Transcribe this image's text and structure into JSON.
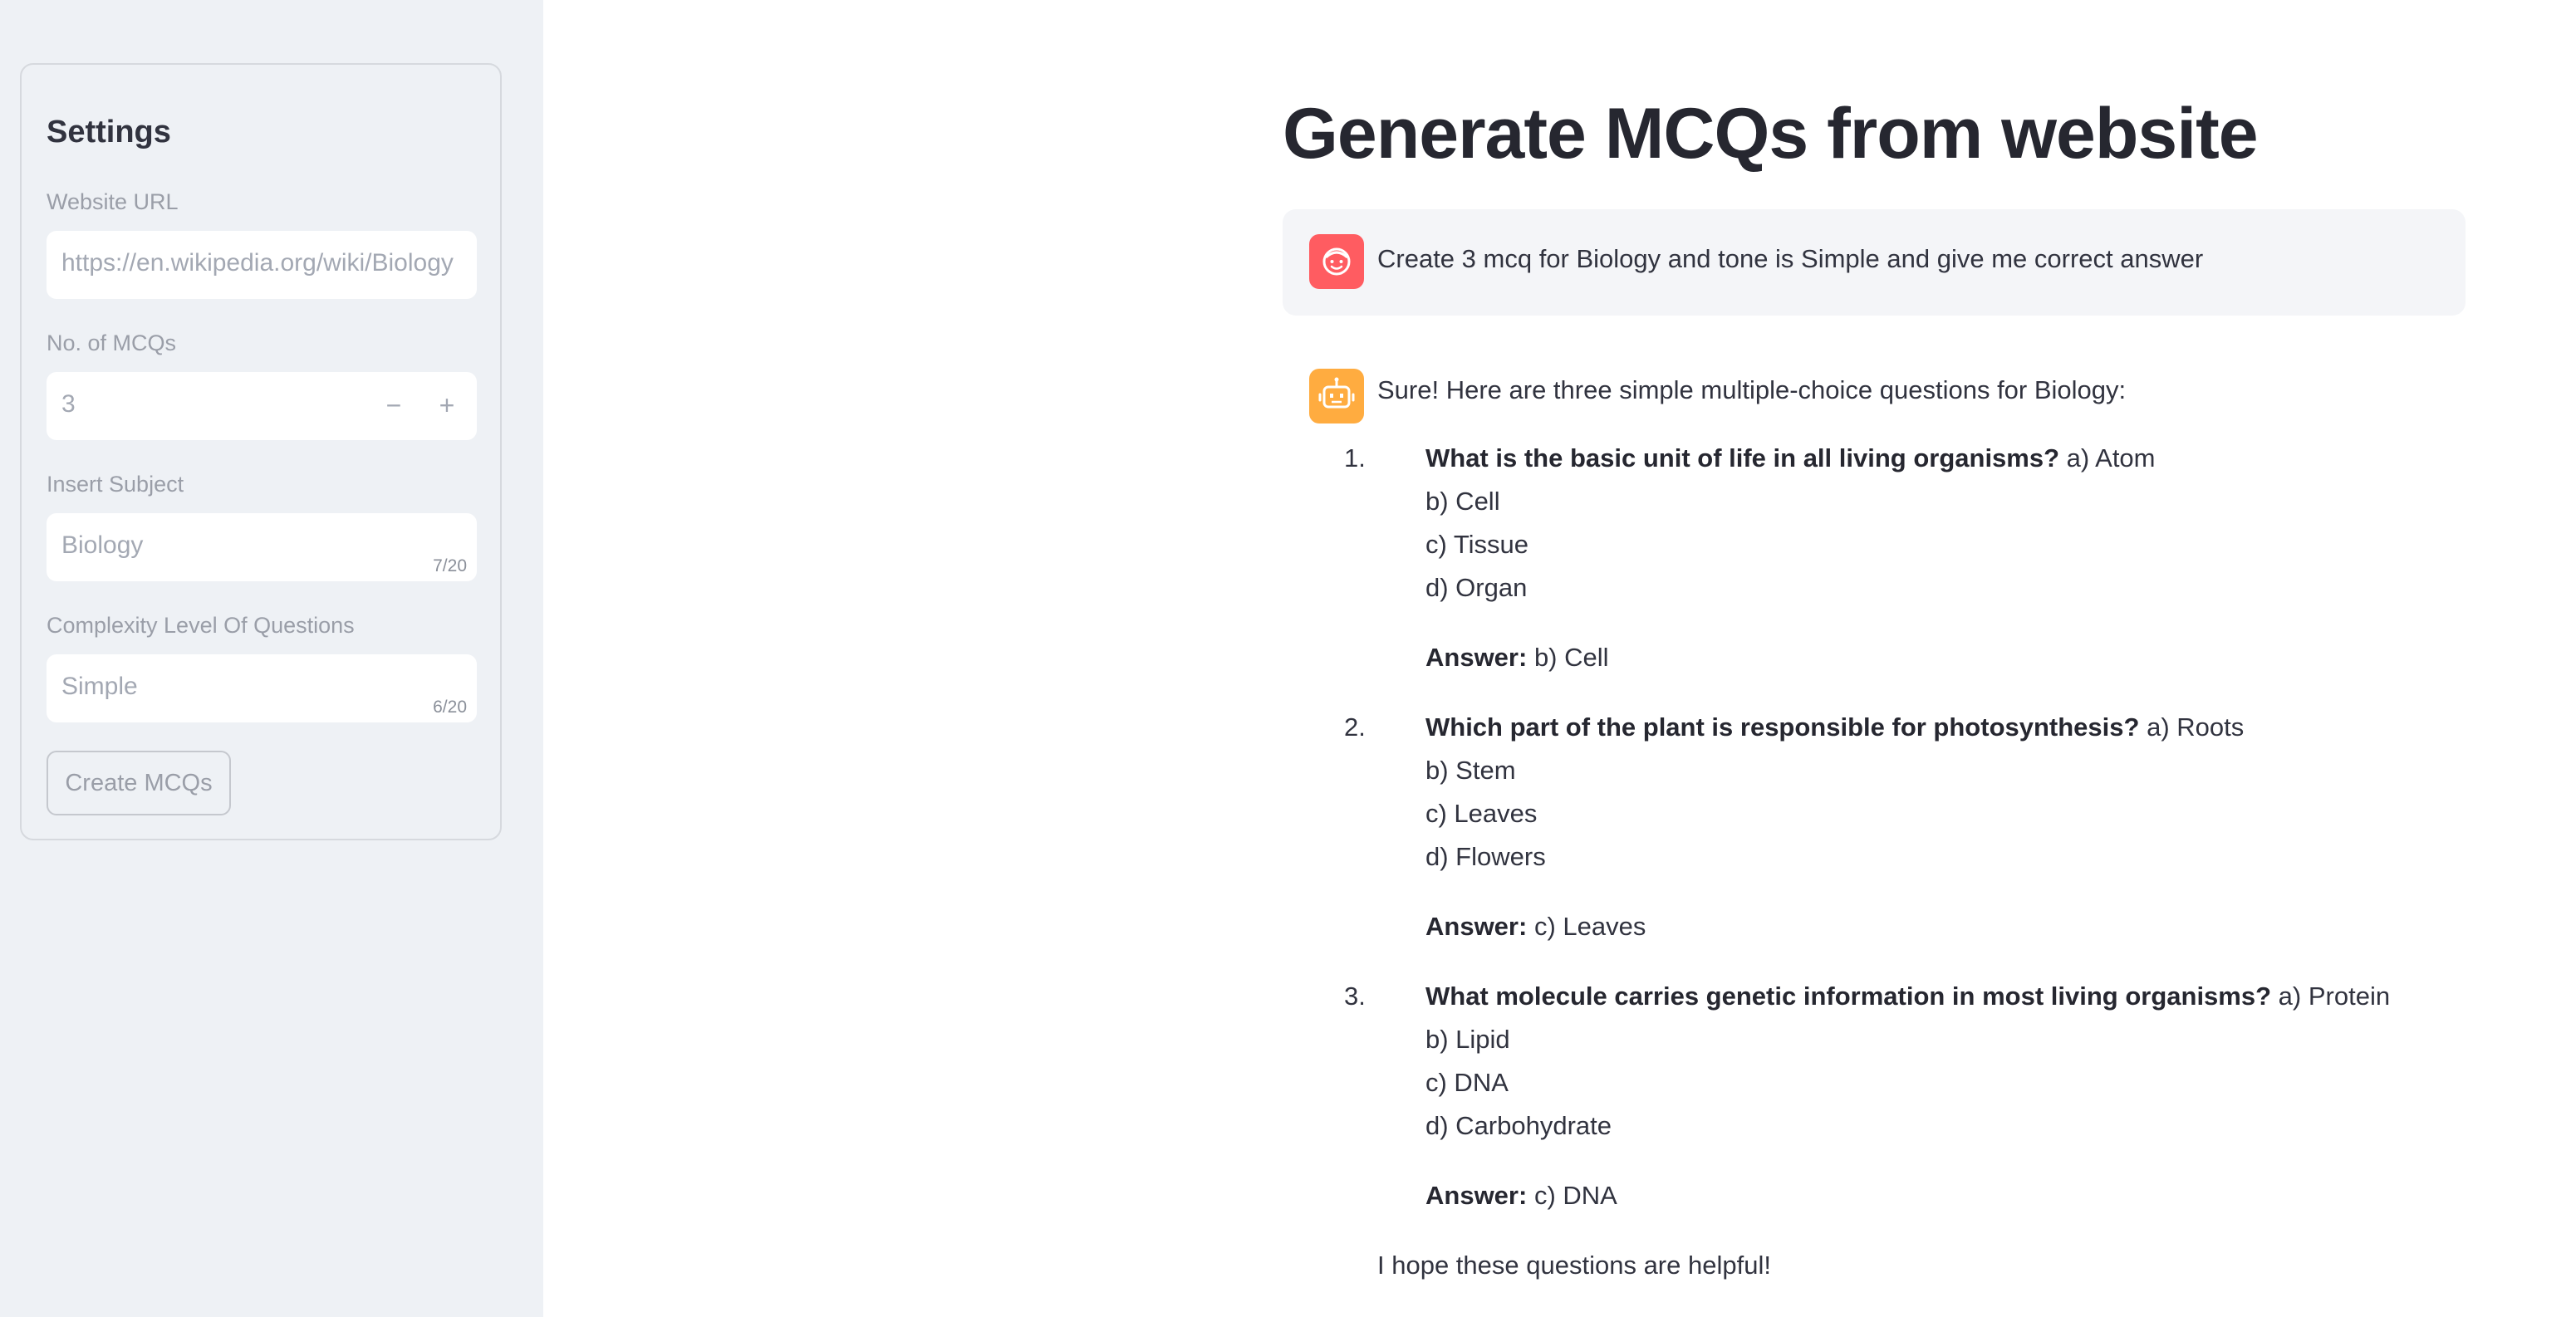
{
  "sidebar": {
    "title": "Settings",
    "url_label": "Website URL",
    "url_value": "https://en.wikipedia.org/wiki/Biology",
    "mcq_label": "No. of MCQs",
    "mcq_value": "3",
    "minus": "−",
    "plus": "+",
    "subject_label": "Insert Subject",
    "subject_value": "Biology",
    "subject_counter": "7/20",
    "complexity_label": "Complexity Level Of Questions",
    "complexity_value": "Simple",
    "complexity_counter": "6/20",
    "create_button": "Create MCQs"
  },
  "main": {
    "title": "Generate MCQs from website",
    "user_message": "Create 3 mcq for Biology and tone is Simple and give me correct answer",
    "bot_intro": "Sure! Here are three simple multiple-choice questions for Biology:",
    "answer_label": "Answer:",
    "questions": [
      {
        "num": "1.",
        "question": "What is the basic unit of life in all living organisms?",
        "a": "a) Atom",
        "b": "b) Cell",
        "c": "c) Tissue",
        "d": "d) Organ",
        "answer": "b) Cell"
      },
      {
        "num": "2.",
        "question": "Which part of the plant is responsible for photosynthesis?",
        "a": "a) Roots",
        "b": "b) Stem",
        "c": "c) Leaves",
        "d": "d) Flowers",
        "answer": "c) Leaves"
      },
      {
        "num": "3.",
        "question": "What molecule carries genetic information in most living organisms?",
        "a": "a) Protein",
        "b": "b) Lipid",
        "c": "c) DNA",
        "d": "d) Carbohydrate",
        "answer": "c) DNA"
      }
    ],
    "closing": "I hope these questions are helpful!"
  }
}
